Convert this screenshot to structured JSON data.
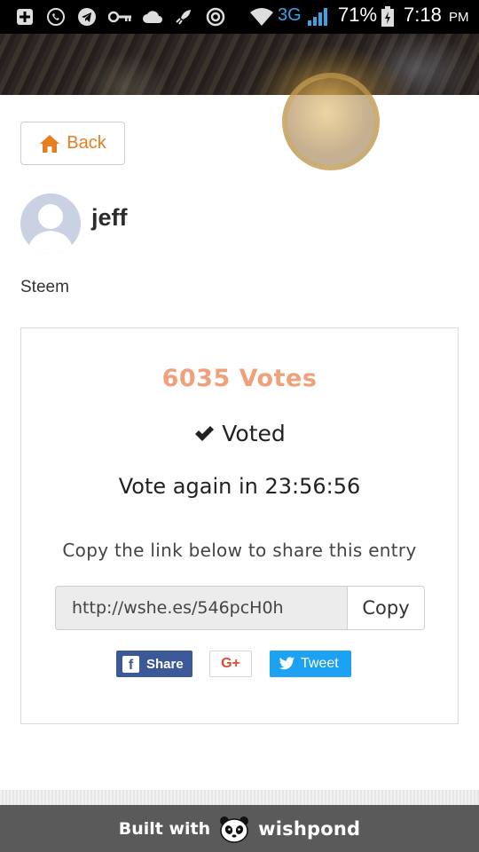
{
  "status_bar": {
    "network": "3G",
    "battery": "71%",
    "time": "7:18",
    "ampm": "PM",
    "icons": [
      "plus-box-icon",
      "whatsapp-icon",
      "telegram-icon",
      "vpn-key-icon",
      "cloud-icon",
      "rocket-icon",
      "chrome-icon",
      "wifi-icon",
      "signal-icon",
      "battery-icon"
    ]
  },
  "nav": {
    "back_label": "Back"
  },
  "profile": {
    "name": "jeff",
    "category": "Steem"
  },
  "entry": {
    "votes": "6035 Votes",
    "voted_label": "Voted",
    "vote_again": "Vote again in 23:56:56",
    "share_hint": "Copy the link below to share this entry",
    "share_link": "http://wshe.es/546pcH0h",
    "copy_label": "Copy"
  },
  "social": {
    "facebook_label": "Share",
    "gplus_label": "G+",
    "twitter_label": "Tweet"
  },
  "footer": {
    "built_with": "Built with",
    "brand": "wishpond"
  },
  "colors": {
    "accent": "#e67e22",
    "votes": "#f0a07a",
    "facebook": "#3b5998",
    "twitter": "#1da1f2",
    "gplus": "#dd4b39",
    "footer_bg": "#5a5a5a"
  }
}
